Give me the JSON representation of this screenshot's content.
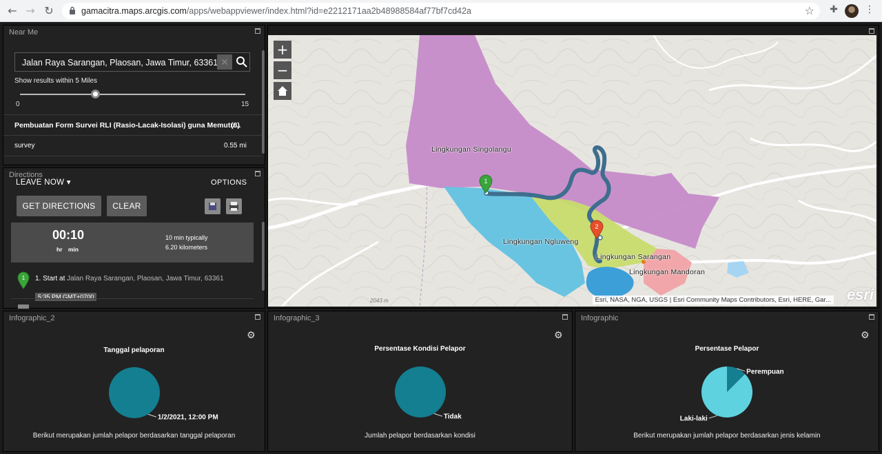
{
  "browser": {
    "url_domain": "gamacitra.maps.arcgis.com",
    "url_path": "/apps/webappviewer/index.html?id=e2212171aa2b48988584af77bf7cd42a"
  },
  "near_me": {
    "title": "Near Me",
    "search_value": "Jalan Raya Sarangan, Plaosan, Jawa Timur, 63361",
    "within_label": "Show results within 5 Miles",
    "slider_min": "0",
    "slider_max": "15",
    "slider_value": 5,
    "result_title": "Pembuatan Form Survei RLI (Rasio-Lacak-Isolasi) guna Memutu...",
    "result_count": "(8)",
    "item_name": "survey",
    "item_distance": "0.55 mi"
  },
  "directions": {
    "title": "Directions",
    "leave_now": "LEAVE NOW",
    "options": "OPTIONS",
    "get_directions": "GET DIRECTIONS",
    "clear": "CLEAR",
    "time": "00:10",
    "time_units": "hr min",
    "typically": "10 min typically",
    "distance": "6.20 kilometers",
    "step_number": "1",
    "step_prefix": "1. Start at",
    "step_location": "Jalan Raya Sarangan, Plaosan, Jawa Timur, 63361",
    "timestamp": "5:35 PM GMT+0700"
  },
  "map": {
    "zoom_in": "+",
    "zoom_out": "−",
    "labels": {
      "singolangu": "Lingkungan Singolangu",
      "ngluweng": "Lingkungan Ngluweng",
      "sarangan": "Lingkungan Sarangan",
      "mandoran": "Lingkungan Mandoran"
    },
    "marker1": "1",
    "marker2": "2",
    "elevation": "2043 m",
    "attribution": "Esri, NASA, NGA, USGS | Esri Community Maps Contributors, Esri, HERE, Gar...",
    "logo": "esri",
    "colors": {
      "purple": "#c68bc9",
      "cyan": "#62c2e0",
      "green": "#c8dc6c",
      "pink": "#f1a2a5",
      "route": "#3e6e8e"
    }
  },
  "infographic_2": {
    "title": "Infographic_2",
    "chart_title": "Tanggal pelaporan",
    "description": "Berikut merupakan jumlah pelapor berdasarkan tanggal pelaporan"
  },
  "infographic_3": {
    "title": "Infographic_3",
    "chart_title": "Persentase Kondisi Pelapor",
    "description": "Jumlah pelapor berdasarkan kondisi"
  },
  "infographic": {
    "title": "Infographic",
    "chart_title": "Persentase Pelapor",
    "description": "Berikut merupakan jumlah pelapor berdasarkan jenis kelamin"
  },
  "chart_data": [
    {
      "type": "pie",
      "title": "Tanggal pelaporan",
      "categories": [
        "1/2/2021, 12:00 PM"
      ],
      "values": [
        8
      ],
      "colors": [
        "#137f91"
      ]
    },
    {
      "type": "pie",
      "title": "Persentase Kondisi Pelapor",
      "categories": [
        "Tidak"
      ],
      "values": [
        8
      ],
      "colors": [
        "#137f91"
      ]
    },
    {
      "type": "pie",
      "title": "Persentase Pelapor",
      "categories": [
        "Perempuan",
        "Laki-laki"
      ],
      "values": [
        1,
        7
      ],
      "colors": [
        "#137f91",
        "#5fd2e0"
      ]
    }
  ]
}
